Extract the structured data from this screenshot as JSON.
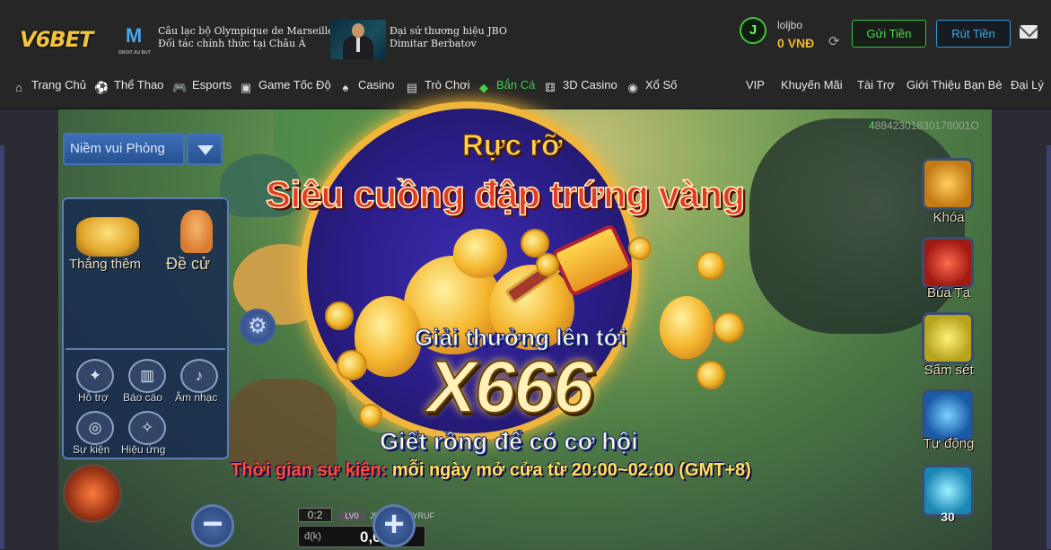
{
  "header": {
    "logo": "V6BET",
    "club_crest_text": "M",
    "club_crest_caption": "DROIT AU BUT",
    "partner_line1": "Câu lạc bộ Olympique de Marseille",
    "partner_line2": "Đối tác chính thức tại Châu Á",
    "ambassador_line1": "Đại sứ thương hiệu JBO",
    "ambassador_line2": "Dimitar Berbatov",
    "avatar_letter": "J",
    "username": "loljbo",
    "balance": "0",
    "currency": "VNĐ",
    "deposit_label": "Gửi Tiền",
    "withdraw_label": "Rút Tiền"
  },
  "nav": {
    "items": [
      {
        "label": "Trang Chủ",
        "icon": "home-icon"
      },
      {
        "label": "Thể Thao",
        "icon": "soccer-ball-icon"
      },
      {
        "label": "Esports",
        "icon": "gamepad-icon"
      },
      {
        "label": "Game Tốc Độ",
        "icon": "speed-game-icon"
      },
      {
        "label": "Casino",
        "icon": "cards-icon"
      },
      {
        "label": "Trò Chơi",
        "icon": "slot-machine-icon"
      },
      {
        "label": "Bắn Cá",
        "icon": "fish-icon",
        "active": true
      },
      {
        "label": "3D Casino",
        "icon": "dice-icon"
      },
      {
        "label": "Xổ Số",
        "icon": "lottery-ball-icon"
      }
    ],
    "right_items": [
      "VIP",
      "Khuyến Mãi",
      "Tài Trợ",
      "Giới Thiệu Bạn Bè",
      "Đại Lý"
    ]
  },
  "game": {
    "id_prefix": "4",
    "id_rest": "8842301830178001O",
    "room_select": "Niềm vui Phòng",
    "menu": {
      "earn_more": "Thắng thêm",
      "recommend": "Đề cử",
      "support": "Hỗ trợ",
      "report": "Báo cáo",
      "music": "Âm nhạc",
      "events": "Sự kiện",
      "effects": "Hiệu ứng"
    },
    "multiplier": "0:2",
    "level": "LV0",
    "player_name": "JBolj8KTTYYRUF",
    "bet_unit": "đ(k)",
    "bet_value": "0,00",
    "tools": [
      {
        "label": "Khóa",
        "icon": "lock-target-icon"
      },
      {
        "label": "Búa Tạ",
        "icon": "hammer-icon"
      },
      {
        "label": "Sấm sét",
        "icon": "lightning-icon"
      },
      {
        "label": "Tự động",
        "icon": "auto-icon"
      },
      {
        "label": "",
        "icon": "burst-icon"
      }
    ],
    "tool_count": "30"
  },
  "promo": {
    "line1": "Rực rỡ",
    "line2": "Siêu cuồng đập trứng vàng",
    "line3": "Giải thưởng lên tới",
    "multiplier": "X666",
    "line4": "Giết rồng để có cơ hội",
    "time_label": "Thời gian sự kiện:",
    "time_value": " mỗi ngày mở cửa từ 20:00~02:00 (GMT+8)"
  }
}
